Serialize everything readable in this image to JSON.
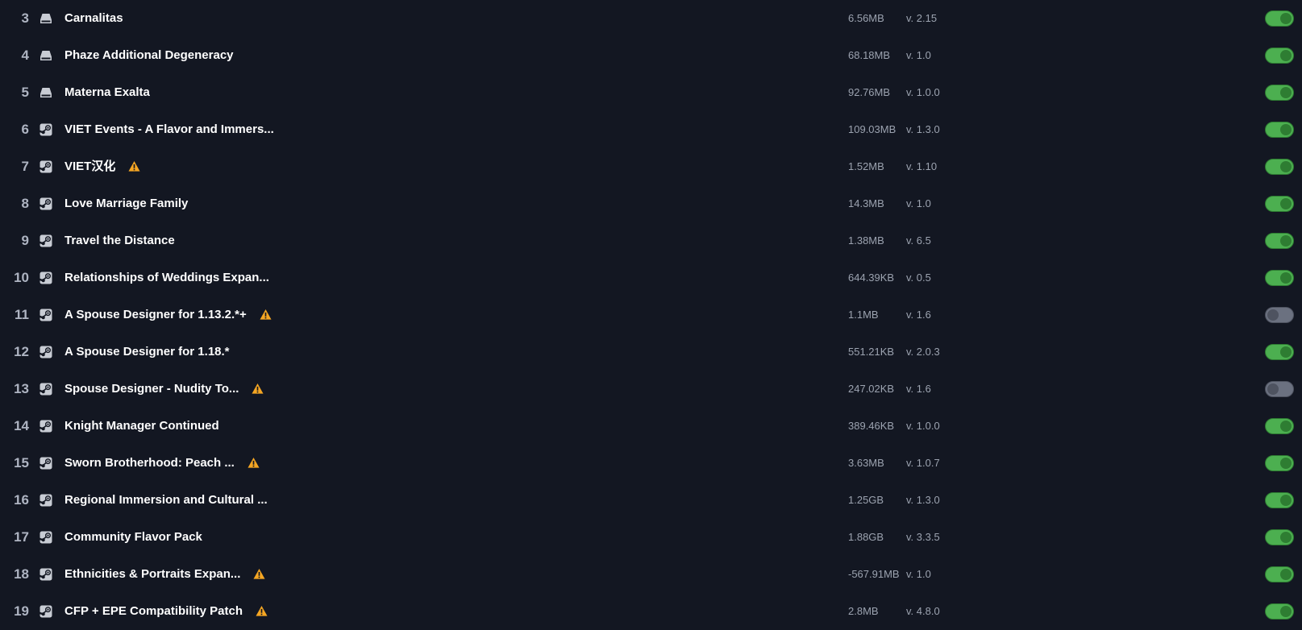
{
  "colors": {
    "background": "#131722",
    "toggle_on": "#4caf50",
    "toggle_off": "#6b7180",
    "warning": "#f5a623"
  },
  "mods": [
    {
      "index": "3",
      "source": "local-drive-icon",
      "name": "Carnalitas",
      "warning": false,
      "size": "6.56MB",
      "version": "v. 2.15",
      "enabled": true
    },
    {
      "index": "4",
      "source": "local-drive-icon",
      "name": "Phaze Additional Degeneracy",
      "warning": false,
      "size": "68.18MB",
      "version": "v. 1.0",
      "enabled": true
    },
    {
      "index": "5",
      "source": "local-drive-icon",
      "name": "Materna Exalta",
      "warning": false,
      "size": "92.76MB",
      "version": "v. 1.0.0",
      "enabled": true
    },
    {
      "index": "6",
      "source": "steam-icon",
      "name": "VIET Events - A Flavor and Immers...",
      "warning": false,
      "size": "109.03MB",
      "version": "v. 1.3.0",
      "enabled": true
    },
    {
      "index": "7",
      "source": "steam-icon",
      "name": "VIET汉化",
      "warning": true,
      "size": "1.52MB",
      "version": "v. 1.10",
      "enabled": true
    },
    {
      "index": "8",
      "source": "steam-icon",
      "name": "Love Marriage Family",
      "warning": false,
      "size": "14.3MB",
      "version": "v. 1.0",
      "enabled": true
    },
    {
      "index": "9",
      "source": "steam-icon",
      "name": "Travel the Distance",
      "warning": false,
      "size": "1.38MB",
      "version": "v. 6.5",
      "enabled": true
    },
    {
      "index": "10",
      "source": "steam-icon",
      "name": "Relationships of Weddings Expan...",
      "warning": false,
      "size": "644.39KB",
      "version": "v. 0.5",
      "enabled": true
    },
    {
      "index": "11",
      "source": "steam-icon",
      "name": "A Spouse Designer for 1.13.2.*+",
      "warning": true,
      "size": "1.1MB",
      "version": "v. 1.6",
      "enabled": false
    },
    {
      "index": "12",
      "source": "steam-icon",
      "name": "A Spouse Designer for 1.18.*",
      "warning": false,
      "size": "551.21KB",
      "version": "v. 2.0.3",
      "enabled": true
    },
    {
      "index": "13",
      "source": "steam-icon",
      "name": "Spouse Designer - Nudity To...",
      "warning": true,
      "size": "247.02KB",
      "version": "v. 1.6",
      "enabled": false
    },
    {
      "index": "14",
      "source": "steam-icon",
      "name": "Knight Manager Continued",
      "warning": false,
      "size": "389.46KB",
      "version": "v. 1.0.0",
      "enabled": true
    },
    {
      "index": "15",
      "source": "steam-icon",
      "name": "Sworn Brotherhood: Peach ...",
      "warning": true,
      "size": "3.63MB",
      "version": "v. 1.0.7",
      "enabled": true
    },
    {
      "index": "16",
      "source": "steam-icon",
      "name": "Regional Immersion and Cultural ...",
      "warning": false,
      "size": "1.25GB",
      "version": "v. 1.3.0",
      "enabled": true
    },
    {
      "index": "17",
      "source": "steam-icon",
      "name": "Community Flavor Pack",
      "warning": false,
      "size": "1.88GB",
      "version": "v. 3.3.5",
      "enabled": true
    },
    {
      "index": "18",
      "source": "steam-icon",
      "name": "Ethnicities & Portraits Expan...",
      "warning": true,
      "size": "-567.91MB",
      "version": "v. 1.0",
      "enabled": true
    },
    {
      "index": "19",
      "source": "steam-icon",
      "name": "CFP + EPE Compatibility Patch",
      "warning": true,
      "size": "2.8MB",
      "version": "v. 4.8.0",
      "enabled": true
    }
  ]
}
